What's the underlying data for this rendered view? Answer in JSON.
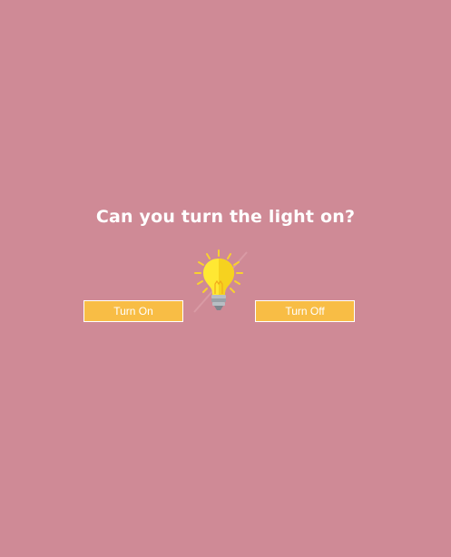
{
  "question": "Can you turn the light on?",
  "buttons": {
    "on_label": "Turn On",
    "off_label": "Turn Off"
  },
  "bulb": {
    "icon": "light-bulb-icon",
    "state": "on"
  },
  "colors": {
    "background": "#cf8a96",
    "button": "#f8bd45",
    "bulb_glass": "#ffe833",
    "rays": "#f9d12f",
    "text": "#ffffff"
  }
}
